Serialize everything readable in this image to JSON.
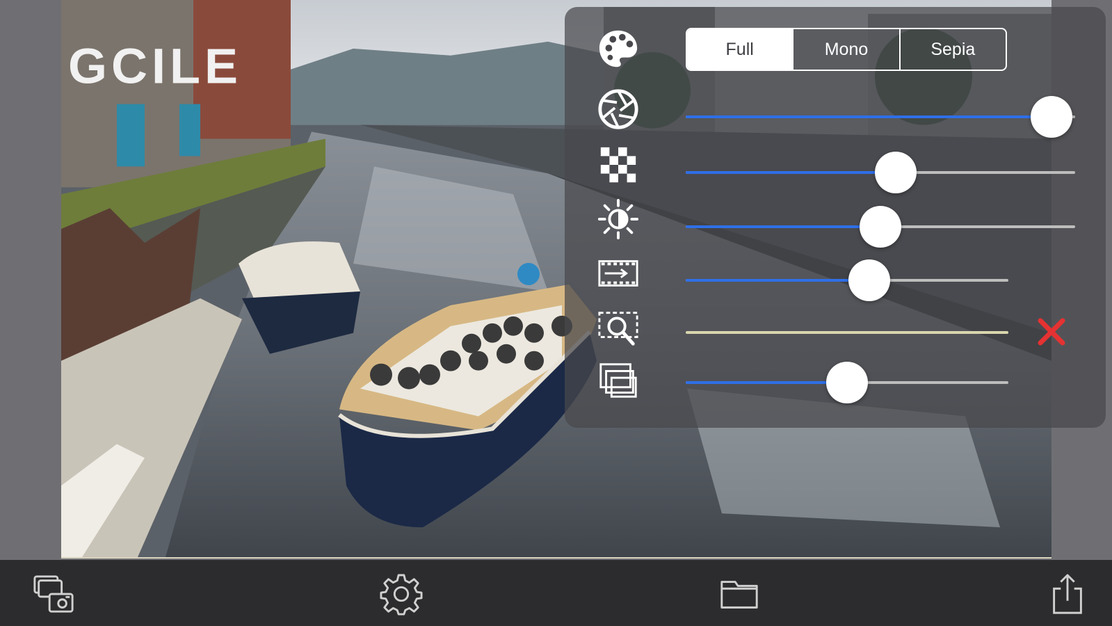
{
  "filter_panel": {
    "mode_segments": [
      {
        "label": "Full",
        "selected": true
      },
      {
        "label": "Mono",
        "selected": false
      },
      {
        "label": "Sepia",
        "selected": false
      }
    ],
    "sliders": [
      {
        "icon": "aperture-icon",
        "value": 0.94
      },
      {
        "icon": "checkerboard-icon",
        "value": 0.54
      },
      {
        "icon": "brightness-icon",
        "value": 0.5
      },
      {
        "icon": "film-strip-icon",
        "value": 0.57
      },
      {
        "icon": "zoom-detail-icon",
        "value": null
      },
      {
        "icon": "layers-icon",
        "value": 0.5
      }
    ],
    "accent_color": "#2f6fe8",
    "close_color": "#e53232"
  },
  "toolbar": {
    "buttons": [
      "switch-camera-icon",
      "settings-gear-icon",
      "folder-icon",
      "share-icon"
    ]
  }
}
